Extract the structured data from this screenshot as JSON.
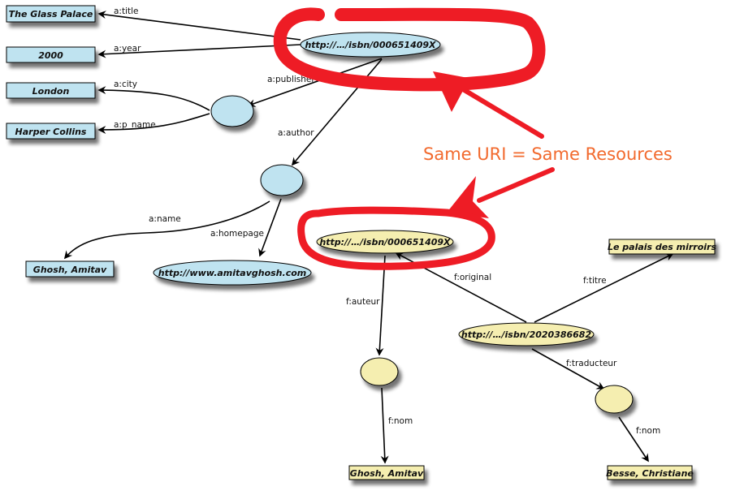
{
  "colors": {
    "english_fill": "#bfe3f0",
    "french_fill": "#f5eeb0",
    "annotation": "#ee1c25",
    "annotation_text": "#f26a2e"
  },
  "english_graph": {
    "book_uri": "http://…/isbn/000651409X",
    "literals": {
      "title": "The Glass Palace",
      "year": "2000",
      "city": "London",
      "publisher_name": "Harper Collins",
      "author_name": "Ghosh, Amitav",
      "homepage": "http://www.amitavghosh.com"
    },
    "edges": {
      "title": "a:title",
      "year": "a:year",
      "publisher": "a:publisher",
      "city": "a:city",
      "p_name": "a:p_name",
      "author": "a:author",
      "name": "a:name",
      "homepage": "a:homepage"
    }
  },
  "french_graph": {
    "book_uri": "http://…/isbn/000651409X",
    "translation_uri": "http://…/isbn/2020386682",
    "literals": {
      "titre": "Le palais des mirroirs",
      "auteur_nom": "Ghosh, Amitav",
      "traducteur_nom": "Besse, Christiane"
    },
    "edges": {
      "original": "f:original",
      "titre": "f:titre",
      "auteur": "f:auteur",
      "traducteur": "f:traducteur",
      "nom_auteur": "f:nom",
      "nom_traducteur": "f:nom"
    }
  },
  "annotation": {
    "text": "Same URI = Same Resources"
  }
}
